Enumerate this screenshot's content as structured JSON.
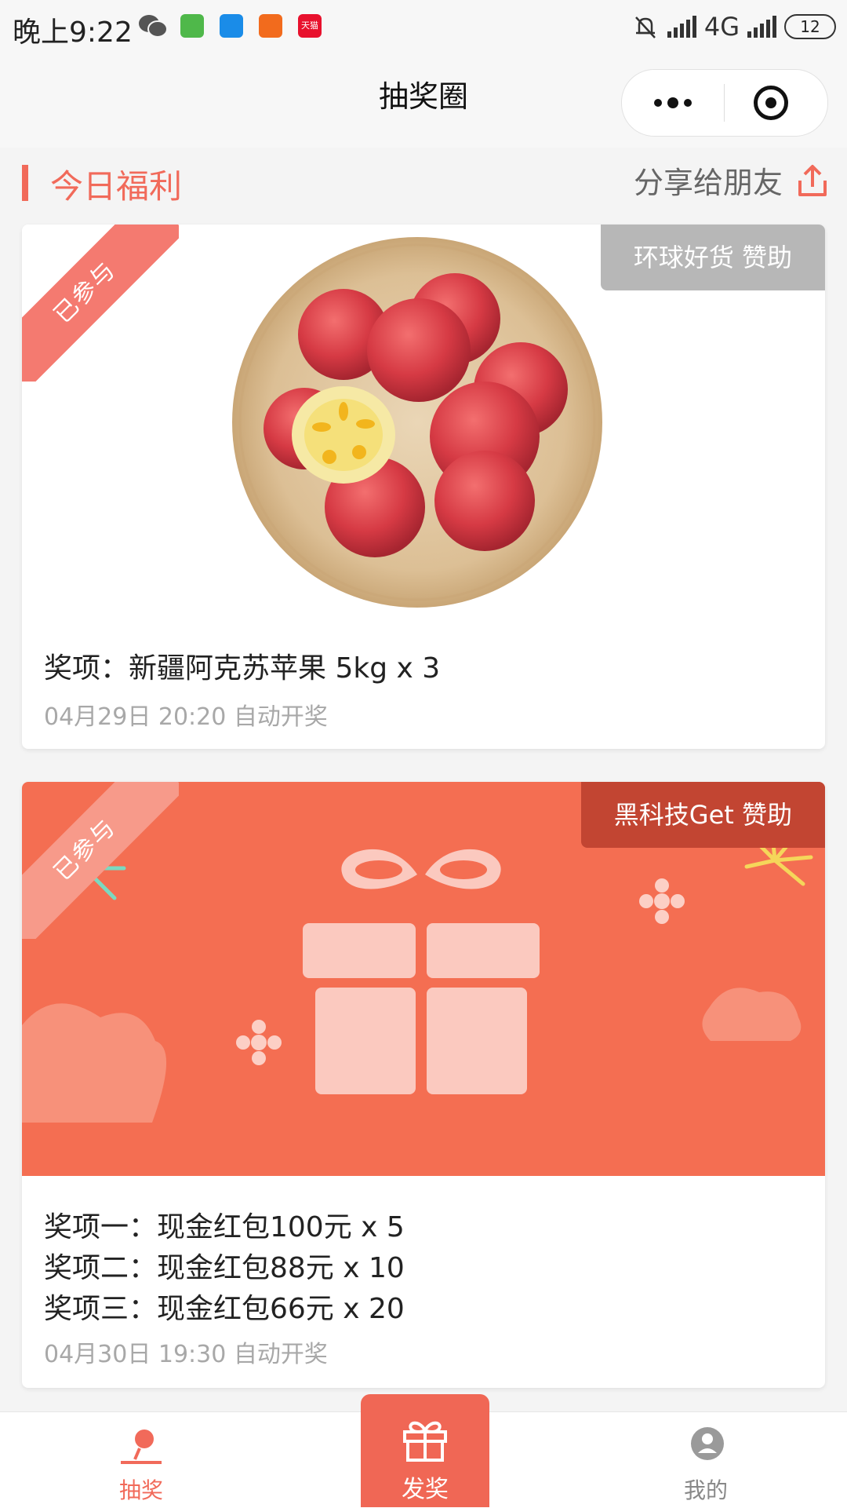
{
  "status_bar": {
    "time": "晚上9:22",
    "network": "4G",
    "battery": "12",
    "notification_icons": [
      {
        "name": "wechat-icon",
        "color": "#555555"
      },
      {
        "name": "app-green-icon",
        "color": "#4fb84a"
      },
      {
        "name": "app-blue-icon",
        "color": "#1a8ce8"
      },
      {
        "name": "app-orange-icon",
        "color": "#f26b1d"
      },
      {
        "name": "tmall-icon",
        "color": "#e8112d",
        "text": "天猫"
      }
    ]
  },
  "nav": {
    "title": "抽奖圈"
  },
  "section": {
    "title": "今日福利",
    "share_label": "分享给朋友"
  },
  "cards": [
    {
      "badge": "已参与",
      "sponsor": "环球好货 赞助",
      "image": "apples-in-bamboo-basket",
      "prizes": [
        "奖项：新疆阿克苏苹果 5kg x 3"
      ],
      "draw_time": "04月29日 20:20 自动开奖"
    },
    {
      "badge": "已参与",
      "sponsor": "黑科技Get 赞助",
      "image": "gift-box-illustration",
      "prizes": [
        "奖项一：现金红包100元 x 5",
        "奖项二：现金红包88元 x 10",
        "奖项三：现金红包66元 x 20"
      ],
      "draw_time": "04月30日 19:30 自动开奖"
    }
  ],
  "tabbar": {
    "items": [
      {
        "label": "抽奖",
        "icon": "lottery-icon",
        "active": true
      },
      {
        "label": "发奖",
        "icon": "gift-icon",
        "active": false
      },
      {
        "label": "我的",
        "icon": "user-icon",
        "active": false
      }
    ]
  },
  "colors": {
    "accent": "#f16a5a",
    "card2_bg": "#f46e52",
    "sponsor1_bg": "#b7b7b7",
    "sponsor2_bg": "#c24532"
  }
}
